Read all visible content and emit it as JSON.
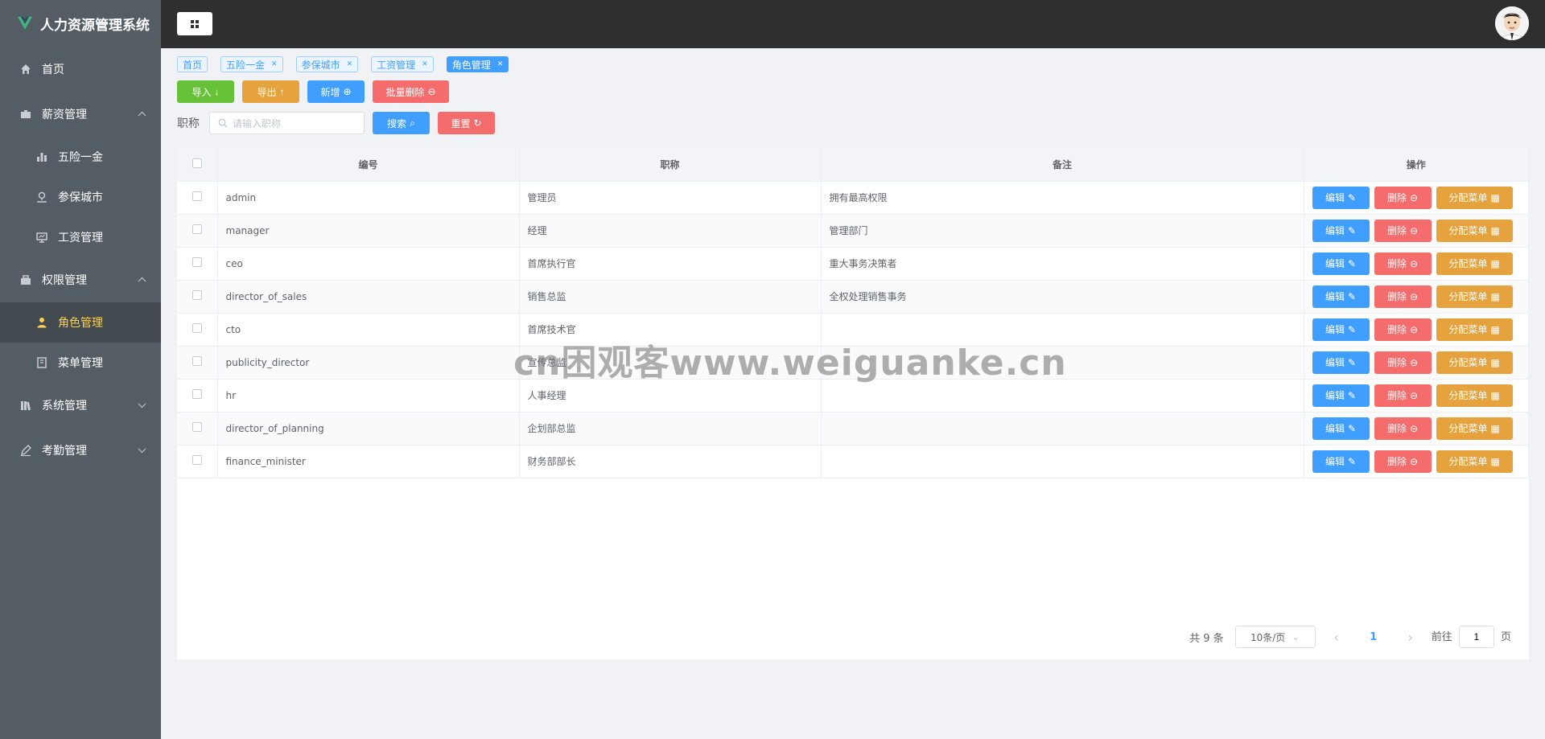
{
  "app": {
    "title": "人力资源管理系统",
    "logo_color": "#41b883"
  },
  "sidebar": {
    "items": [
      {
        "label": "首页",
        "icon": "home-icon"
      },
      {
        "label": "薪资管理",
        "icon": "briefcase-icon",
        "expanded": true,
        "children": [
          {
            "label": "五险一金",
            "icon": "bar-chart-icon"
          },
          {
            "label": "参保城市",
            "icon": "location-icon"
          },
          {
            "label": "工资管理",
            "icon": "monitor-icon"
          }
        ]
      },
      {
        "label": "权限管理",
        "icon": "lock-icon",
        "expanded": true,
        "children": [
          {
            "label": "角色管理",
            "icon": "user-icon",
            "active": true
          },
          {
            "label": "菜单管理",
            "icon": "notebook-icon"
          }
        ]
      },
      {
        "label": "系统管理",
        "icon": "books-icon",
        "expanded": false
      },
      {
        "label": "考勤管理",
        "icon": "pen-icon",
        "expanded": false
      }
    ]
  },
  "tabs": [
    {
      "label": "首页",
      "closable": false
    },
    {
      "label": "五险一金",
      "closable": true
    },
    {
      "label": "参保城市",
      "closable": true
    },
    {
      "label": "工资管理",
      "closable": true
    },
    {
      "label": "角色管理",
      "closable": true,
      "active": true
    }
  ],
  "toolbar": {
    "import": "导入",
    "export": "导出",
    "add": "新增",
    "batch_delete": "批量删除"
  },
  "search": {
    "label": "职称",
    "placeholder": "请输入职称",
    "value": "",
    "search_btn": "搜索",
    "reset_btn": "重置"
  },
  "table": {
    "headers": [
      "编号",
      "职称",
      "备注",
      "操作"
    ],
    "rows": [
      {
        "code": "admin",
        "title": "管理员",
        "note": "拥有最高权限"
      },
      {
        "code": "manager",
        "title": "经理",
        "note": "管理部门"
      },
      {
        "code": "ceo",
        "title": "首席执行官",
        "note": "重大事务决策者"
      },
      {
        "code": "director_of_sales",
        "title": "销售总监",
        "note": "全权处理销售事务"
      },
      {
        "code": "cto",
        "title": "首席技术官",
        "note": ""
      },
      {
        "code": "publicity_director",
        "title": "宣传总监",
        "note": ""
      },
      {
        "code": "hr",
        "title": "人事经理",
        "note": ""
      },
      {
        "code": "director_of_planning",
        "title": "企划部总监",
        "note": ""
      },
      {
        "code": "finance_minister",
        "title": "财务部部长",
        "note": ""
      }
    ],
    "actions": {
      "edit": "编辑",
      "delete": "删除",
      "assign": "分配菜单"
    }
  },
  "pagination": {
    "total_text": "共 9 条",
    "page_size": "10条/页",
    "current_page": "1",
    "goto_label": "前往",
    "goto_value": "1",
    "page_suffix": "页"
  },
  "watermark": "cn困观客www.weiguanke.cn",
  "colors": {
    "sidebar_bg": "#545c64",
    "header_bg": "#2f2f2f",
    "primary": "#409eff",
    "success": "#67c23a",
    "warning": "#e6a23c",
    "danger": "#f56c6c",
    "active_menu_text": "#ffd04b"
  }
}
